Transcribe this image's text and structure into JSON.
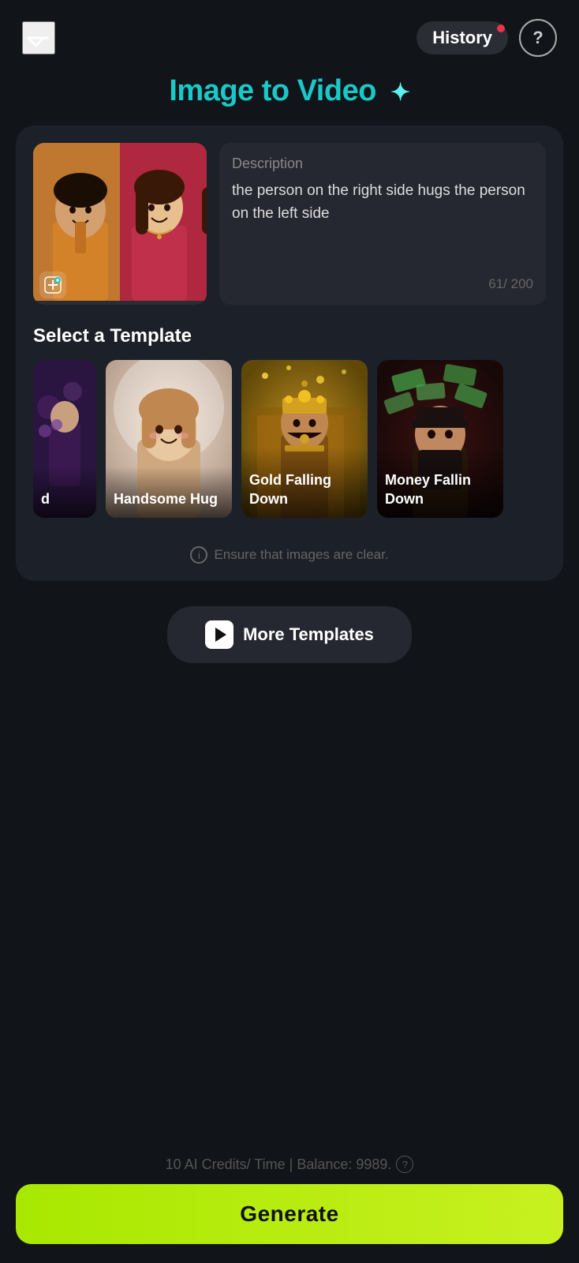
{
  "app": {
    "title": "Image to Video"
  },
  "nav": {
    "back_label": "back",
    "history_label": "History",
    "help_label": "?"
  },
  "description": {
    "label": "Description",
    "text": "the person on the right side hugs the person on the left side",
    "char_current": "61",
    "char_max": "200",
    "char_display": "61/ 200"
  },
  "template_section": {
    "title": "Select a Template"
  },
  "templates": [
    {
      "id": 1,
      "label": "d",
      "bg": "purple"
    },
    {
      "id": 2,
      "label": "Handsome Hug",
      "bg": "warm"
    },
    {
      "id": 3,
      "label": "Gold Falling Down",
      "bg": "gold"
    },
    {
      "id": 4,
      "label": "Money Fallin Down",
      "bg": "dark"
    }
  ],
  "hint": {
    "text": "Ensure that images are clear."
  },
  "more_templates": {
    "label": "More Templates"
  },
  "footer": {
    "credits_text": "10 AI Credits/ Time  |  Balance: 9989.",
    "generate_label": "Generate"
  }
}
